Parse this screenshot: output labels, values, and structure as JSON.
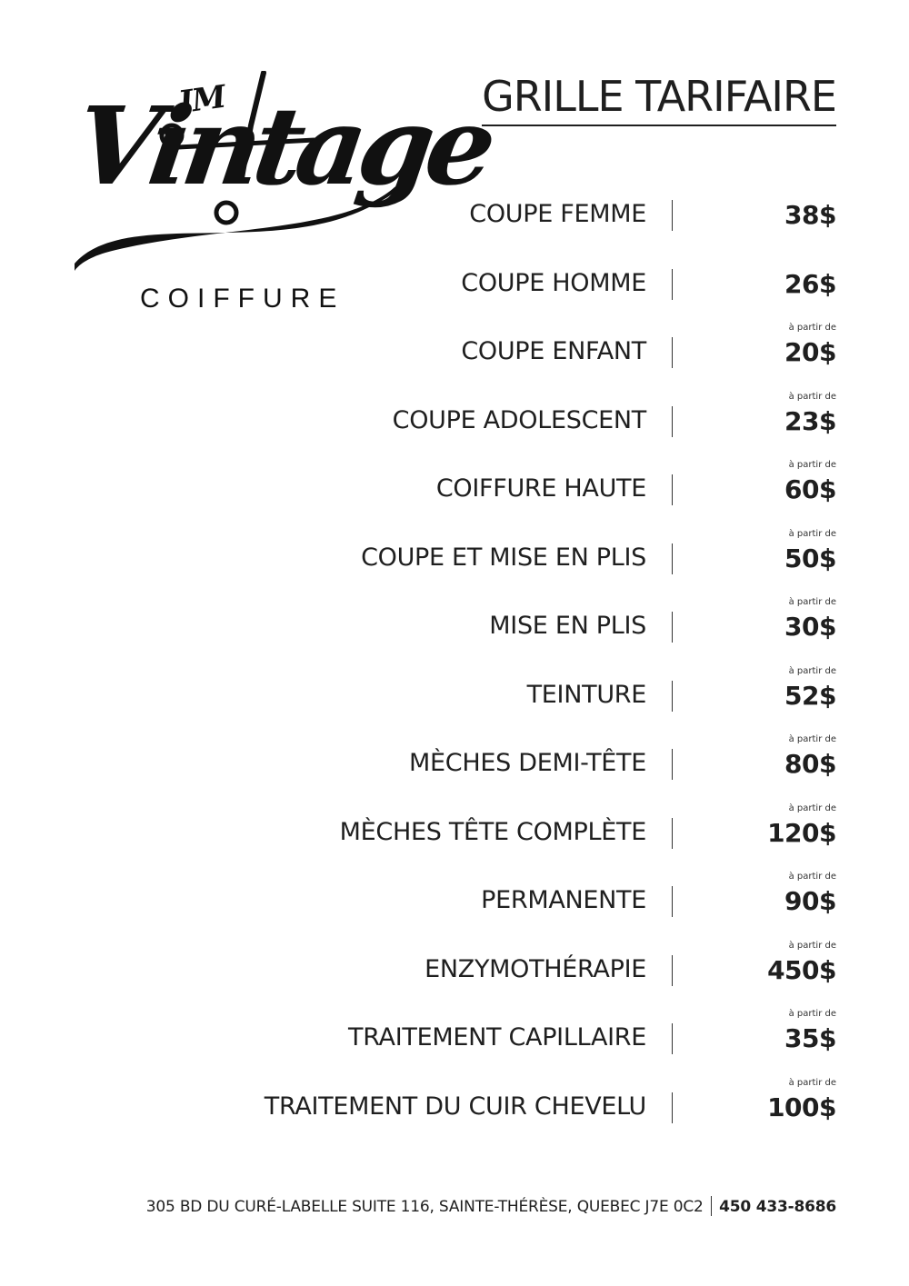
{
  "logo": {
    "initials": "JM",
    "wordmark": "Vintage",
    "subtitle": "COIFFURE"
  },
  "title": "GRILLE TARIFAIRE",
  "from_label": "à partir de",
  "items": [
    {
      "name": "COUPE FEMME",
      "price": "38$",
      "from": false
    },
    {
      "name": "COUPE HOMME",
      "price": "26$",
      "from": false
    },
    {
      "name": "COUPE ENFANT",
      "price": "20$",
      "from": true
    },
    {
      "name": "COUPE ADOLESCENT",
      "price": "23$",
      "from": true
    },
    {
      "name": "COIFFURE HAUTE",
      "price": "60$",
      "from": true
    },
    {
      "name": "COUPE ET MISE EN PLIS",
      "price": "50$",
      "from": true
    },
    {
      "name": "MISE EN PLIS",
      "price": "30$",
      "from": true
    },
    {
      "name": "TEINTURE",
      "price": "52$",
      "from": true
    },
    {
      "name": "MÈCHES DEMI-TÊTE",
      "price": "80$",
      "from": true
    },
    {
      "name": "MÈCHES TÊTE COMPLÈTE",
      "price": "120$",
      "from": true
    },
    {
      "name": "PERMANENTE",
      "price": "90$",
      "from": true
    },
    {
      "name": "ENZYMOTHÉRAPIE",
      "price": "450$",
      "from": true
    },
    {
      "name": "TRAITEMENT CAPILLAIRE",
      "price": "35$",
      "from": true
    },
    {
      "name": "TRAITEMENT DU CUIR CHEVELU",
      "price": "100$",
      "from": true
    }
  ],
  "footer": {
    "address": "305 BD DU CURÉ-LABELLE SUITE 116, SAINTE-THÉRÈSE, QUEBEC J7E 0C2",
    "phone": "450 433-8686"
  }
}
